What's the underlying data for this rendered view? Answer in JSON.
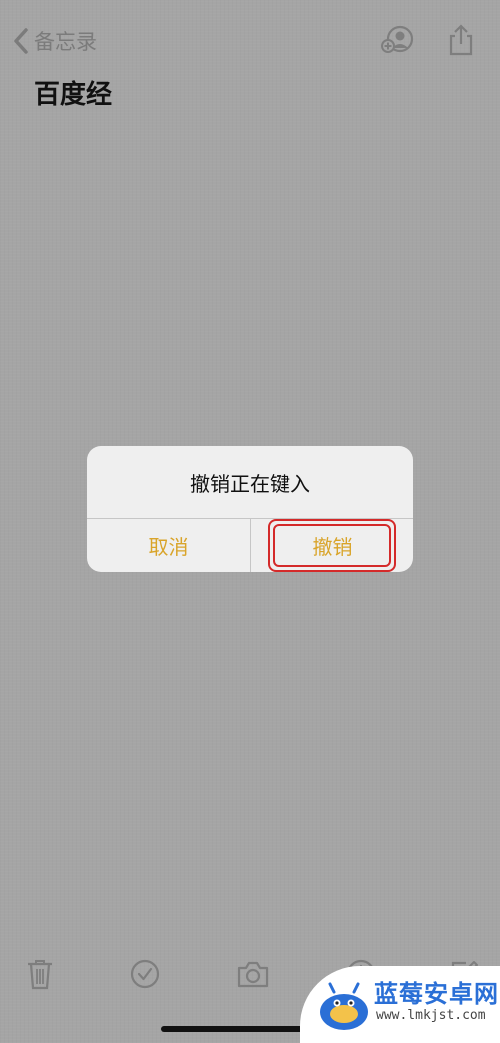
{
  "nav": {
    "back_label": "备忘录"
  },
  "note": {
    "title": "百度经"
  },
  "alert": {
    "title": "撤销正在键入",
    "cancel_label": "取消",
    "undo_label": "撤销",
    "button_color": "#d9a42a",
    "highlight_color": "#d42a2a"
  },
  "toolbar": {
    "icons": [
      "trash-icon",
      "checklist-icon",
      "camera-icon",
      "markup-icon",
      "compose-icon"
    ]
  },
  "watermark": {
    "brand": "蓝莓安卓网",
    "url": "www.lmkjst.com"
  }
}
